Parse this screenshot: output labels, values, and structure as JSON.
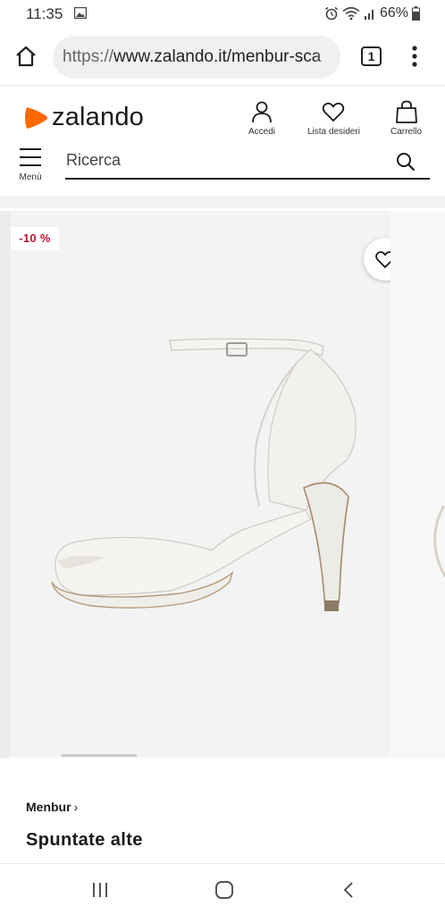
{
  "status_bar": {
    "time": "11:35",
    "battery": "66%",
    "icons": [
      "image-icon",
      "alarm-icon",
      "wifi-icon",
      "signal-icon",
      "battery-icon"
    ]
  },
  "browser": {
    "url_scheme": "https://",
    "url_rest": "www.zalando.it/menbur-sca",
    "tab_count": "1",
    "icons": [
      "home-icon",
      "more-vert-icon"
    ]
  },
  "site": {
    "logo_text": "zalando",
    "brand_color": "#ff6900",
    "actions": {
      "login": "Accedi",
      "wishlist": "Lista desideri",
      "cart": "Carrello"
    },
    "menu_label": "Menù",
    "search_placeholder": "Ricerca"
  },
  "product": {
    "discount": "-10 %",
    "discount_color": "#c2132f",
    "brand": "Menbur",
    "brand_chevron": "›",
    "name": "Spuntate alte"
  },
  "nav_bar": {
    "icons": [
      "recent-apps-icon",
      "home-button-icon",
      "back-icon"
    ]
  }
}
